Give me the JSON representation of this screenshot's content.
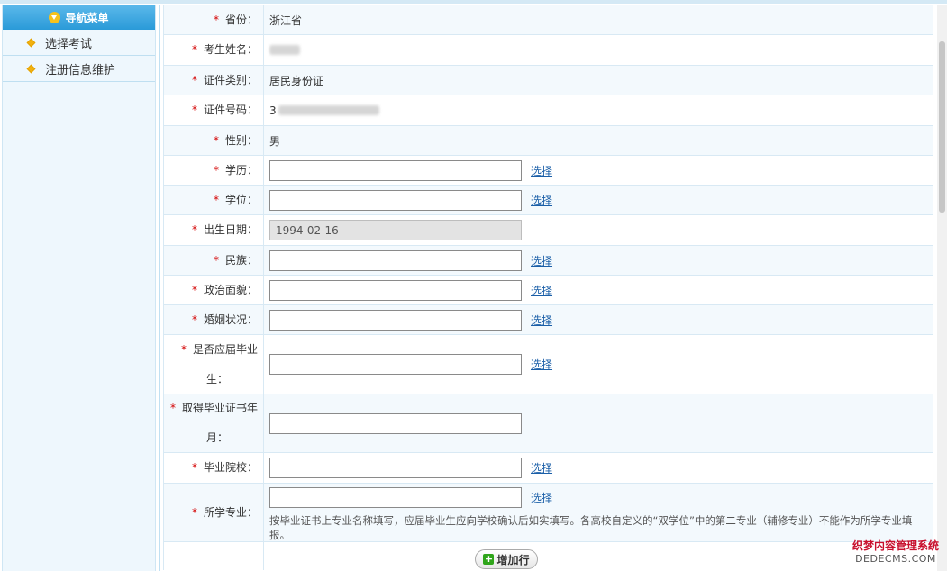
{
  "sidebar": {
    "title": "导航菜单",
    "items": [
      {
        "label": "选择考试"
      },
      {
        "label": "注册信息维护"
      }
    ]
  },
  "form": {
    "required_mark": "*",
    "choose_label": "选择",
    "province": {
      "label": "省份：",
      "value": "浙江省"
    },
    "name": {
      "label": "考生姓名："
    },
    "id_type": {
      "label": "证件类别：",
      "value": "居民身份证"
    },
    "id_number": {
      "label": "证件号码：",
      "value_prefix": "3"
    },
    "gender": {
      "label": "性别：",
      "value": "男"
    },
    "education": {
      "label": "学历：",
      "value": ""
    },
    "degree": {
      "label": "学位：",
      "value": ""
    },
    "birth_date": {
      "label": "出生日期：",
      "value": "1994-02-16"
    },
    "ethnicity": {
      "label": "民族：",
      "value": ""
    },
    "political": {
      "label": "政治面貌：",
      "value": ""
    },
    "marital": {
      "label": "婚姻状况：",
      "value": ""
    },
    "fresh_grad": {
      "label_line1": "是否应届毕业",
      "label_line2": "生：",
      "value": ""
    },
    "grad_cert": {
      "label_line1": "取得毕业证书年",
      "label_line2": "月：",
      "value": ""
    },
    "school": {
      "label": "毕业院校：",
      "value": ""
    },
    "major": {
      "label": "所学专业：",
      "value": "",
      "note": "按毕业证书上专业名称填写，应届毕业生应向学校确认后如实填写。各高校自定义的“双学位”中的第二专业（辅修专业）不能作为所学专业填报。"
    },
    "add_row_button": "增加行"
  },
  "watermark": {
    "line1": "织梦内容管理系统",
    "line2": "DEDECMS.COM"
  }
}
